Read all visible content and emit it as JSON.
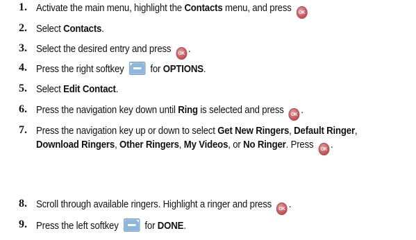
{
  "ok_icon": {
    "label": "OK",
    "icon": "ok-button-icon",
    "color": "#c9585e"
  },
  "softkey_icon": {
    "icon": "softkey-icon",
    "color": "#7da8cf"
  },
  "steps": [
    {
      "num": "1.",
      "p1": "Activate the main menu, highlight the ",
      "b1": "Contacts",
      "p2": " menu, and press "
    },
    {
      "num": "2.",
      "p1": "Select ",
      "b1": "Contacts",
      "p2": "."
    },
    {
      "num": "3.",
      "p1": "Select the desired entry and press ",
      "p2": "."
    },
    {
      "num": "4.",
      "p1": "Press the right softkey ",
      "p2": " for ",
      "b1": "OPTIONS",
      "p3": "."
    },
    {
      "num": "5.",
      "p1": "Select ",
      "b1": "Edit Contact",
      "p2": "."
    },
    {
      "num": "6.",
      "p1": "Press the navigation key down until ",
      "b1": "Ring",
      "p2": " is selected and press ",
      "p3": "."
    },
    {
      "num": "7.",
      "p1": "Press the navigation key up or down to select ",
      "b1": "Get New Ringers",
      "p2": ", ",
      "b2": "Default Ringer",
      "p3": ", ",
      "b3": "Download Ringers",
      "p4": ", ",
      "b4": "Other Ringers",
      "p5": ", ",
      "b5": "My Videos",
      "p6": ", or ",
      "b6": "No Ringer",
      "p7": ". Press ",
      "p8": "."
    },
    {
      "num": "8.",
      "p1": "Scroll through available ringers. Highlight a ringer and press ",
      "p2": "."
    },
    {
      "num": "9.",
      "p1": "Press the left softkey ",
      "p2": " for ",
      "b1": "DONE",
      "p3": "."
    }
  ]
}
